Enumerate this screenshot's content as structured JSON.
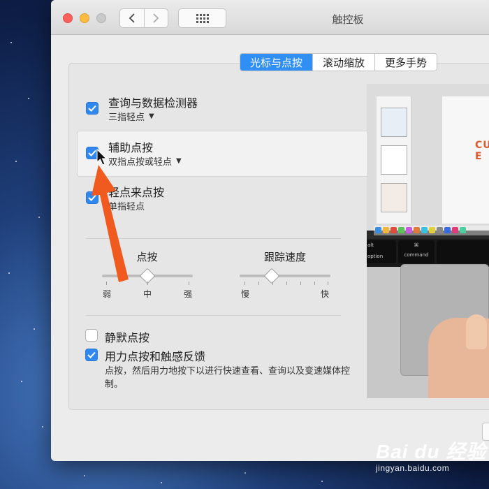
{
  "window": {
    "title": "触控板"
  },
  "tabs": [
    {
      "label": "光标与点按",
      "active": true
    },
    {
      "label": "滚动缩放",
      "active": false
    },
    {
      "label": "更多手势",
      "active": false
    }
  ],
  "options": {
    "lookup": {
      "title": "查询与数据检测器",
      "sub": "三指轻点",
      "checked": true
    },
    "secondary": {
      "title": "辅助点按",
      "sub": "双指点按或轻点",
      "checked": true
    },
    "tap": {
      "title": "轻点来点按",
      "sub": "单指轻点",
      "checked": true
    }
  },
  "sliders": {
    "click": {
      "label": "点按",
      "min_label": "弱",
      "mid_label": "中",
      "max_label": "强",
      "value": 0.5
    },
    "tracking": {
      "label": "跟踪速度",
      "min_label": "慢",
      "max_label": "快",
      "value": 0.35
    }
  },
  "bottom_options": {
    "silent": {
      "label": "静默点按",
      "checked": false
    },
    "force": {
      "label": "用力点按和触感反馈",
      "checked": true,
      "description": "点按，然后用力地按下以进行快速查看、查询以及变速媒体控制。"
    }
  },
  "preview": {
    "keys": [
      {
        "top": "alt",
        "bottom": "option"
      },
      {
        "top": "⌘",
        "bottom": "command"
      }
    ],
    "doc_text": "CU\nE"
  },
  "watermark": {
    "logo": "Bai du 经验",
    "url": "jingyan.baidu.com"
  },
  "colors": {
    "accent": "#2f8ff5",
    "annotation_arrow": "#f05a1e"
  }
}
